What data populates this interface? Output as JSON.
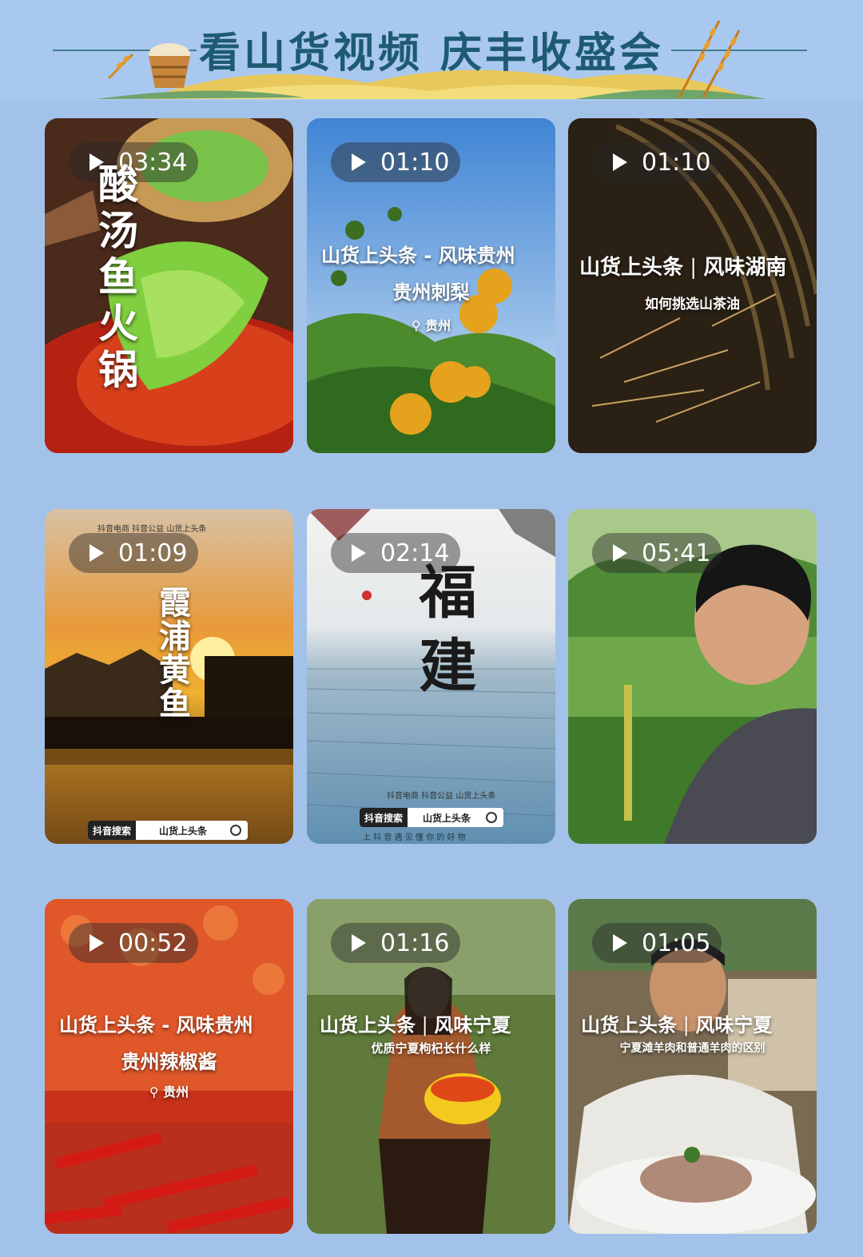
{
  "banner": {
    "title": "看山货视频  庆丰收盛会"
  },
  "colors": {
    "page_bg": "#a3c2ea",
    "title": "#1e5b73",
    "pill_bg": "rgba(40,40,40,0.45)"
  },
  "videos": [
    {
      "duration": "03:34",
      "overlay": "酸汤鱼火锅"
    },
    {
      "duration": "01:10",
      "line1": "山货上头条 - 风味贵州",
      "line2": "贵州刺梨",
      "location": "贵州"
    },
    {
      "duration": "01:10",
      "line1": "山货上头条",
      "line1b": "风味湖南",
      "line2": "如何挑选山茶油"
    },
    {
      "duration": "01:09",
      "overlay": "霞浦黄鱼",
      "logos": "抖音电商  抖音公益  山货上头条",
      "search_label": "抖音搜索",
      "search_query": "山货上头条"
    },
    {
      "duration": "02:14",
      "overlay": "福建",
      "logos": "抖音电商  抖音公益  山货上头条",
      "search_label": "抖音搜索",
      "search_query": "山货上头条",
      "tagline": "上 抖 音   遇 见 懂 你 的 好 物"
    },
    {
      "duration": "05:41"
    },
    {
      "duration": "00:52",
      "line1": "山货上头条 - 风味贵州",
      "line2": "贵州辣椒酱",
      "location": "贵州"
    },
    {
      "duration": "01:16",
      "line1": "山货上头条",
      "line1b": "风味宁夏",
      "line2": "优质宁夏枸杞长什么样"
    },
    {
      "duration": "01:05",
      "line1": "山货上头条",
      "line1b": "风味宁夏",
      "line2": "宁夏滩羊肉和普通羊肉的区别"
    }
  ]
}
